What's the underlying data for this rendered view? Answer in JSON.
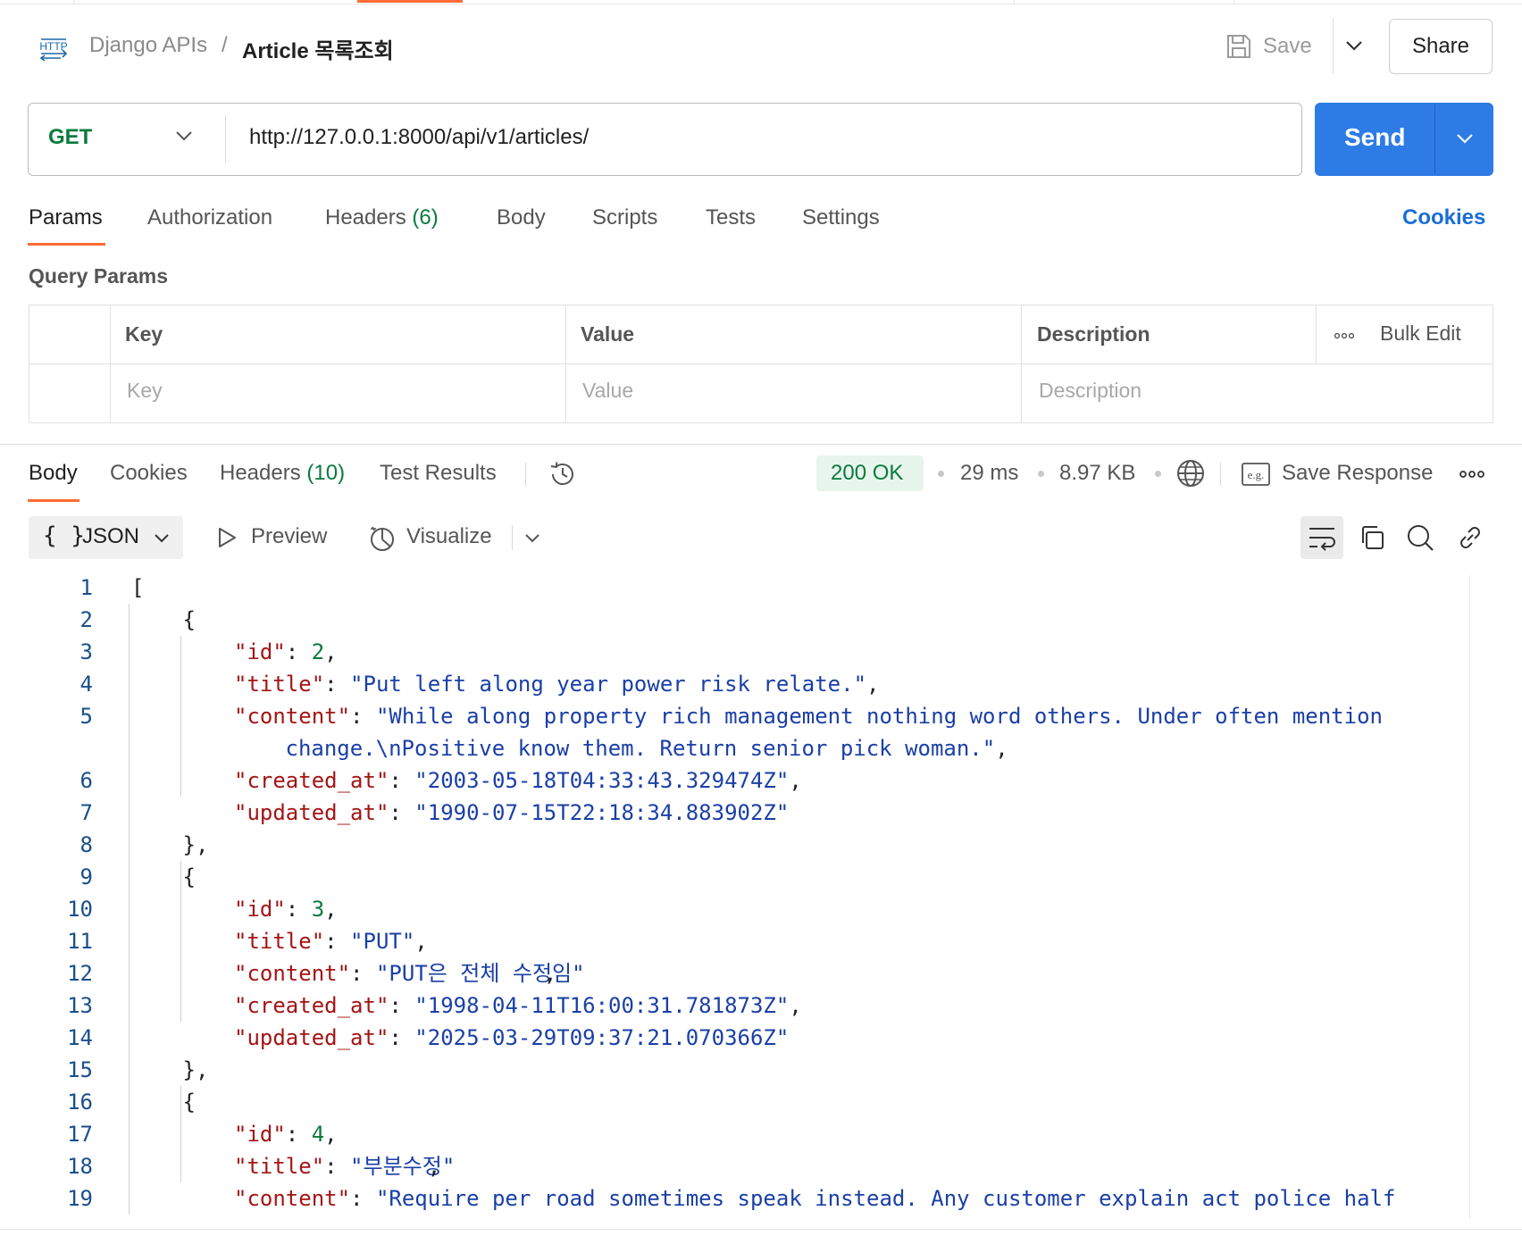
{
  "header": {
    "http_icon_label": "HTTP",
    "breadcrumb_parent": "Django APIs",
    "breadcrumb_separator": "/",
    "title": "Article 목록조회",
    "save_label": "Save",
    "share_label": "Share"
  },
  "request": {
    "method": "GET",
    "url": "http://127.0.0.1:8000/api/v1/articles/",
    "send_label": "Send"
  },
  "request_tabs": {
    "params": "Params",
    "authorization": "Authorization",
    "headers": "Headers",
    "headers_count": "(6)",
    "body": "Body",
    "scripts": "Scripts",
    "tests": "Tests",
    "settings": "Settings",
    "cookies": "Cookies"
  },
  "query_params": {
    "title": "Query Params",
    "col_key": "Key",
    "col_value": "Value",
    "col_description": "Description",
    "bulk_edit": "Bulk Edit",
    "placeholder_key": "Key",
    "placeholder_value": "Value",
    "placeholder_description": "Description"
  },
  "response_tabs": {
    "body": "Body",
    "cookies": "Cookies",
    "headers": "Headers",
    "headers_count": "(10)",
    "test_results": "Test Results"
  },
  "response_meta": {
    "status": "200 OK",
    "time": "29 ms",
    "size": "8.97 KB",
    "save_response": "Save Response",
    "example_icon_label": "e.g."
  },
  "toolbar": {
    "braces": "{ }",
    "format": "JSON",
    "preview": "Preview",
    "visualize": "Visualize"
  },
  "code_lines": [
    {
      "n": "1",
      "indent": 0,
      "tokens": [
        [
          "p",
          "["
        ]
      ]
    },
    {
      "n": "2",
      "indent": 1,
      "tokens": [
        [
          "p",
          "{"
        ]
      ]
    },
    {
      "n": "3",
      "indent": 2,
      "tokens": [
        [
          "k",
          "\"id\""
        ],
        [
          "p",
          ": "
        ],
        [
          "n",
          "2"
        ],
        [
          "p",
          ","
        ]
      ]
    },
    {
      "n": "4",
      "indent": 2,
      "tokens": [
        [
          "k",
          "\"title\""
        ],
        [
          "p",
          ": "
        ],
        [
          "s",
          "\"Put left along year power risk relate.\""
        ],
        [
          "p",
          ","
        ]
      ]
    },
    {
      "n": "5",
      "indent": 2,
      "tokens": [
        [
          "k",
          "\"content\""
        ],
        [
          "p",
          ": "
        ],
        [
          "s",
          "\"While along property rich management nothing word others. Under often mention"
        ]
      ]
    },
    {
      "n": "",
      "indent": 3,
      "tokens": [
        [
          "s",
          "change.\\nPositive know them. Return senior pick woman.\""
        ],
        [
          "p",
          ","
        ]
      ]
    },
    {
      "n": "6",
      "indent": 2,
      "tokens": [
        [
          "k",
          "\"created_at\""
        ],
        [
          "p",
          ": "
        ],
        [
          "s",
          "\"2003-05-18T04:33:43.329474Z\""
        ],
        [
          "p",
          ","
        ]
      ]
    },
    {
      "n": "7",
      "indent": 2,
      "tokens": [
        [
          "k",
          "\"updated_at\""
        ],
        [
          "p",
          ": "
        ],
        [
          "s",
          "\"1990-07-15T22:18:34.883902Z\""
        ]
      ]
    },
    {
      "n": "8",
      "indent": 1,
      "tokens": [
        [
          "p",
          "},"
        ]
      ]
    },
    {
      "n": "9",
      "indent": 1,
      "tokens": [
        [
          "p",
          "{"
        ]
      ]
    },
    {
      "n": "10",
      "indent": 2,
      "tokens": [
        [
          "k",
          "\"id\""
        ],
        [
          "p",
          ": "
        ],
        [
          "n",
          "3"
        ],
        [
          "p",
          ","
        ]
      ]
    },
    {
      "n": "11",
      "indent": 2,
      "tokens": [
        [
          "k",
          "\"title\""
        ],
        [
          "p",
          ": "
        ],
        [
          "s",
          "\"PUT\""
        ],
        [
          "p",
          ","
        ]
      ]
    },
    {
      "n": "12",
      "indent": 2,
      "tokens": [
        [
          "k",
          "\"content\""
        ],
        [
          "p",
          ": "
        ],
        [
          "s",
          "\"PUT은 전체 수정임\""
        ],
        [
          "p",
          ","
        ]
      ]
    },
    {
      "n": "13",
      "indent": 2,
      "tokens": [
        [
          "k",
          "\"created_at\""
        ],
        [
          "p",
          ": "
        ],
        [
          "s",
          "\"1998-04-11T16:00:31.781873Z\""
        ],
        [
          "p",
          ","
        ]
      ]
    },
    {
      "n": "14",
      "indent": 2,
      "tokens": [
        [
          "k",
          "\"updated_at\""
        ],
        [
          "p",
          ": "
        ],
        [
          "s",
          "\"2025-03-29T09:37:21.070366Z\""
        ]
      ]
    },
    {
      "n": "15",
      "indent": 1,
      "tokens": [
        [
          "p",
          "},"
        ]
      ]
    },
    {
      "n": "16",
      "indent": 1,
      "tokens": [
        [
          "p",
          "{"
        ]
      ]
    },
    {
      "n": "17",
      "indent": 2,
      "tokens": [
        [
          "k",
          "\"id\""
        ],
        [
          "p",
          ": "
        ],
        [
          "n",
          "4"
        ],
        [
          "p",
          ","
        ]
      ]
    },
    {
      "n": "18",
      "indent": 2,
      "tokens": [
        [
          "k",
          "\"title\""
        ],
        [
          "p",
          ": "
        ],
        [
          "s",
          "\"부분수정\""
        ],
        [
          "p",
          ","
        ]
      ]
    },
    {
      "n": "19",
      "indent": 2,
      "tokens": [
        [
          "k",
          "\"content\""
        ],
        [
          "p",
          ": "
        ],
        [
          "s",
          "\"Require per road sometimes speak instead. Any customer explain act police half"
        ]
      ]
    }
  ],
  "colors": {
    "accent": "#ff6c37",
    "send_button": "#2d7be5",
    "method_get": "#0b7a3e",
    "status_ok": "#0b7a3e",
    "json_key": "#a31515",
    "json_string": "#1a3fa6",
    "json_number": "#0b7a3e",
    "link": "#1b6ed6"
  },
  "icons": {
    "request_type": "http-icon",
    "save": "floppy-disk-icon",
    "dropdown": "chevron-down-icon",
    "history": "history-icon",
    "globe": "globe-icon",
    "example": "example-icon",
    "more": "more-dots-icon",
    "preview": "play-icon",
    "visualize": "visualize-icon",
    "wrap": "wrap-lines-icon",
    "copy": "copy-icon",
    "search": "search-icon",
    "link": "link-icon"
  }
}
